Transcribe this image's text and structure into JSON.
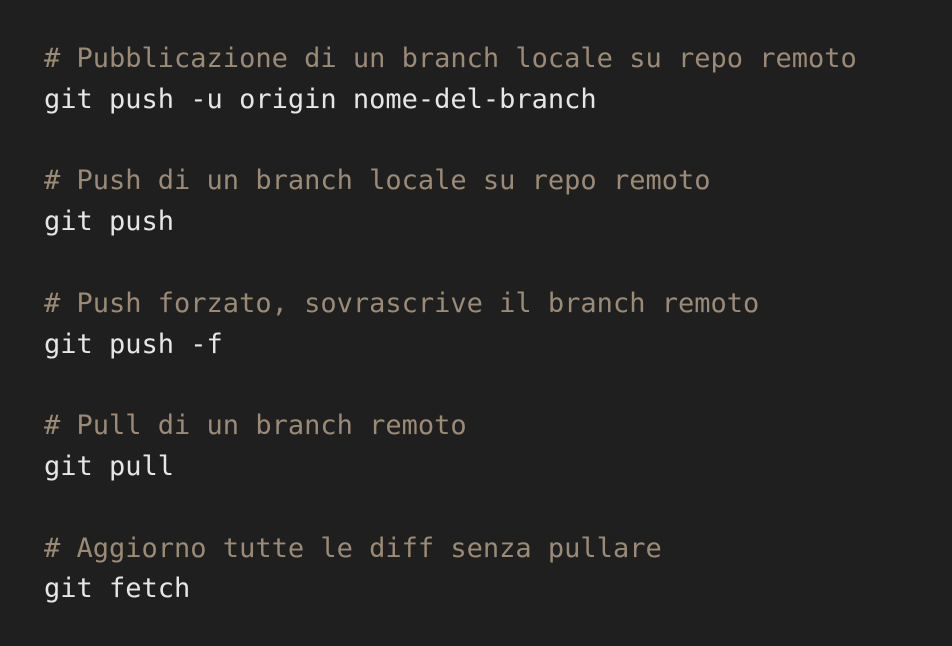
{
  "snippets": [
    {
      "comment": "# Pubblicazione di un branch locale su repo remoto",
      "command": "git push -u origin nome-del-branch"
    },
    {
      "comment": "# Push di un branch locale su repo remoto",
      "command": "git push"
    },
    {
      "comment": "# Push forzato, sovrascrive il branch remoto",
      "command": "git push -f"
    },
    {
      "comment": "# Pull di un branch remoto",
      "command": "git pull"
    },
    {
      "comment": "# Aggiorno tutte le diff senza pullare",
      "command": "git fetch"
    }
  ],
  "colors": {
    "background": "#1f1f1f",
    "comment": "#9b8a76",
    "command": "#e6e6e6"
  }
}
